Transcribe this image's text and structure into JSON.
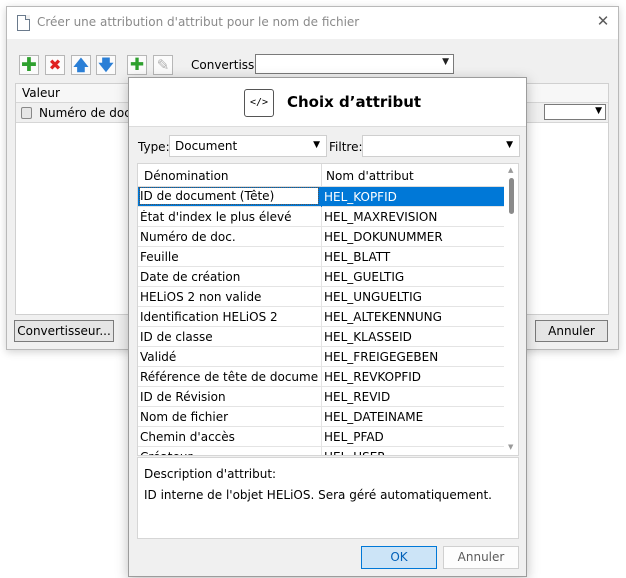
{
  "background_dialog": {
    "title": "Créer une attribution d'attribut pour le nom de fichier",
    "close_glyph": "✕",
    "toolbar": {
      "add_glyph": "✚",
      "delete_glyph": "✖",
      "up_glyph": "🡅",
      "down_glyph": "🡇",
      "add_attribute_glyph": "✚",
      "edit_glyph": "✎",
      "converter_label": "Convertisse"
    },
    "grid": {
      "column_header": "Valeur",
      "row_value": "Numéro de doc."
    },
    "buttons": {
      "converter": "Convertisseur...",
      "cancel": "Annuler"
    }
  },
  "modal": {
    "title": "Choix d’attribut",
    "icon_glyph": "</>",
    "type_label": "Type:",
    "type_value": "Document",
    "filter_label": "Filtre:",
    "filter_value": "",
    "columns": [
      "Dénomination",
      "Nom d'attribut"
    ],
    "rows": [
      {
        "name": "ID de document (Tête)",
        "attr": "HEL_KOPFID"
      },
      {
        "name": "État d'index le plus élevé",
        "attr": "HEL_MAXREVISION"
      },
      {
        "name": "Numéro de doc.",
        "attr": "HEL_DOKUNUMMER"
      },
      {
        "name": "Feuille",
        "attr": "HEL_BLATT"
      },
      {
        "name": "Date de création",
        "attr": "HEL_GUELTIG"
      },
      {
        "name": "HELiOS 2 non valide",
        "attr": "HEL_UNGUELTIG"
      },
      {
        "name": "Identification HELiOS 2",
        "attr": "HEL_ALTEKENNUNG"
      },
      {
        "name": "ID de classe",
        "attr": "HEL_KLASSEID"
      },
      {
        "name": "Validé",
        "attr": "HEL_FREIGEGEBEN"
      },
      {
        "name": "Référence de tête de document",
        "attr": "HEL_REVKOPFID"
      },
      {
        "name": "ID de Révision",
        "attr": "HEL_REVID"
      },
      {
        "name": "Nom de fichier",
        "attr": "HEL_DATEINAME"
      },
      {
        "name": "Chemin d'accès",
        "attr": "HEL_PFAD"
      },
      {
        "name": "Créateur",
        "attr": "HEL_USER"
      }
    ],
    "selected_index": 0,
    "description_label": "Description d'attribut:",
    "description_text": "ID interne de l'objet HELiOS. Sera géré automatiquement.",
    "ok_label": "OK",
    "cancel_label": "Annuler"
  },
  "colors": {
    "selection": "#0078d7",
    "ok_button_bg": "#cce4f7",
    "dialog_bg": "#f0f0f0"
  }
}
